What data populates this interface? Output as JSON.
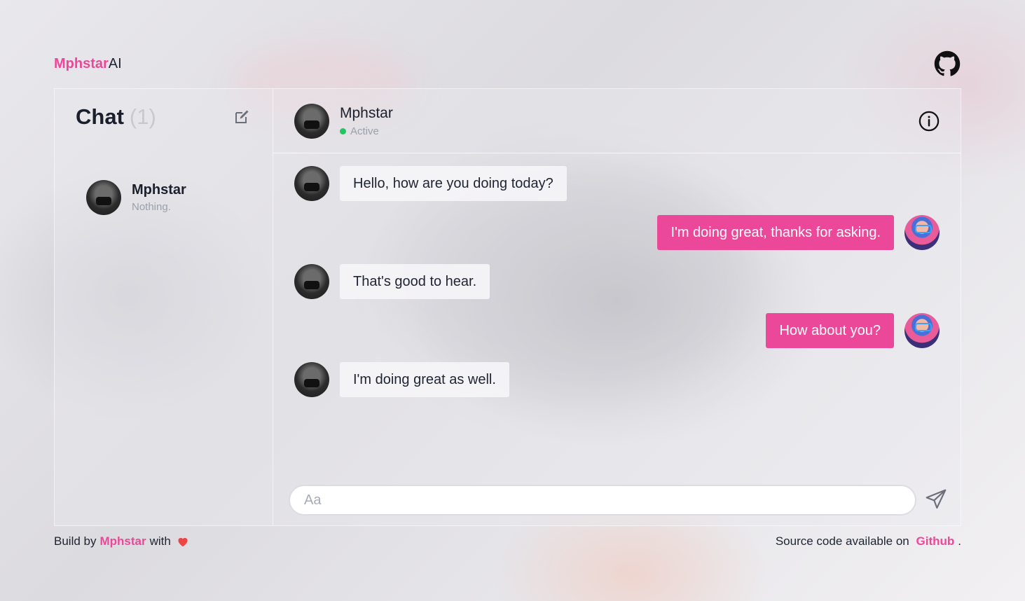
{
  "brand": {
    "primary": "Mphstar",
    "secondary": "AI"
  },
  "colors": {
    "accent": "#ec4899",
    "status_active": "#22c55e",
    "heart": "#ef4444"
  },
  "icons": {
    "github": "github-icon",
    "compose": "compose-icon",
    "info": "info-icon",
    "send": "send-icon",
    "heart": "heart-icon"
  },
  "sidebar": {
    "title": "Chat",
    "count": "(1)",
    "conversations": [
      {
        "name": "Mphstar",
        "preview": "Nothing."
      }
    ]
  },
  "chat": {
    "contact_name": "Mphstar",
    "status": "Active",
    "messages": [
      {
        "from": "contact",
        "text": "Hello, how are you doing today?"
      },
      {
        "from": "user",
        "text": "I'm doing great, thanks for asking."
      },
      {
        "from": "contact",
        "text": "That's good to hear."
      },
      {
        "from": "user",
        "text": "How about you?"
      },
      {
        "from": "contact",
        "text": "I'm doing great as well."
      }
    ],
    "input_placeholder": "Aa",
    "input_value": ""
  },
  "footer": {
    "left_prefix": "Build by",
    "left_link": "Mphstar",
    "left_suffix": "with",
    "right_prefix": "Source code available on",
    "right_link": "Github",
    "right_suffix": "."
  }
}
